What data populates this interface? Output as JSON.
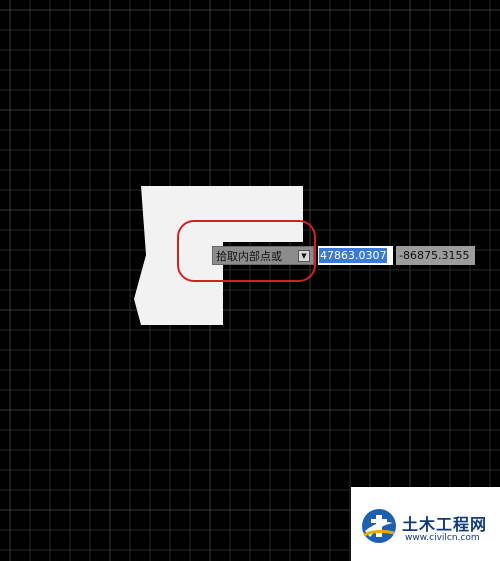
{
  "canvas": {
    "background_color": "#000000",
    "grid_color": "#2a2a2a",
    "grid_major_color": "#3a3a3a",
    "shape_fill_color": "#f2f2f2",
    "highlight_color": "#d62020"
  },
  "command_prompt": {
    "label": "拾取内部点或",
    "dropdown_icon": "dropdown-arrow-icon"
  },
  "coordinates": {
    "x_value": "47863.0307",
    "y_value": "-86875.3155"
  },
  "watermark": {
    "title": "土木工程网",
    "url": "www.civilcn.com",
    "logo_icon": "civilcn-logo-icon",
    "brand_color": "#123b7a"
  }
}
